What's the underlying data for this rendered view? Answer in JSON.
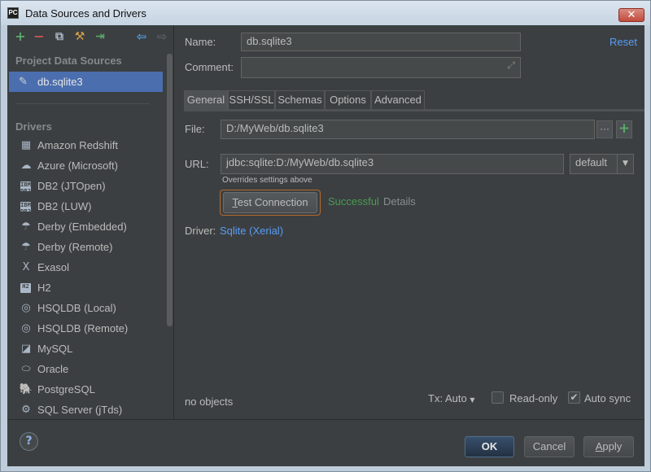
{
  "window": {
    "title": "Data Sources and Drivers",
    "close_glyph": "✕",
    "app_icon_text": "PC"
  },
  "toolbar": {
    "icons": [
      "add-icon",
      "remove-icon",
      "copy-icon",
      "settings-icon",
      "import-icon",
      "back-icon",
      "forward-icon"
    ],
    "glyphs": {
      "add": "+",
      "remove": "−",
      "copy": "⧉",
      "settings": "⚒",
      "import": "⇥",
      "back": "⇦",
      "forward": "⇨"
    }
  },
  "left": {
    "project_section": "Project Data Sources",
    "selected_source": "db.sqlite3",
    "drivers_section": "Drivers",
    "drivers": [
      {
        "label": "Amazon Redshift",
        "icon": "redshift-icon",
        "glyph": "▦"
      },
      {
        "label": "Azure (Microsoft)",
        "icon": "azure-icon",
        "glyph": "☁"
      },
      {
        "label": "DB2 (JTOpen)",
        "icon": "ibm-db2-icon",
        "glyph": "IBM\nDB2"
      },
      {
        "label": "DB2 (LUW)",
        "icon": "ibm-db2-icon",
        "glyph": "IBM\nDB2"
      },
      {
        "label": "Derby (Embedded)",
        "icon": "derby-icon",
        "glyph": "☂"
      },
      {
        "label": "Derby (Remote)",
        "icon": "derby-icon",
        "glyph": "☂"
      },
      {
        "label": "Exasol",
        "icon": "exasol-icon",
        "glyph": "X"
      },
      {
        "label": "H2",
        "icon": "h2-icon",
        "glyph": "H2"
      },
      {
        "label": "HSQLDB (Local)",
        "icon": "hsqldb-icon",
        "glyph": "◎"
      },
      {
        "label": "HSQLDB (Remote)",
        "icon": "hsqldb-icon",
        "glyph": "◎"
      },
      {
        "label": "MySQL",
        "icon": "mysql-icon",
        "glyph": "◪"
      },
      {
        "label": "Oracle",
        "icon": "oracle-icon",
        "glyph": "⬭"
      },
      {
        "label": "PostgreSQL",
        "icon": "postgresql-icon",
        "glyph": "🐘"
      },
      {
        "label": "SQL Server (jTds)",
        "icon": "sqlserver-icon",
        "glyph": "⚙"
      }
    ]
  },
  "form": {
    "name_label": "Name:",
    "name_value": "db.sqlite3",
    "reset_label": "Reset",
    "comment_label": "Comment:",
    "comment_value": "",
    "expand_glyph": "⤢",
    "tabs": [
      {
        "label": "General",
        "active": true
      },
      {
        "label": "SSH/SSL",
        "active": false
      },
      {
        "label": "Schemas",
        "active": false
      },
      {
        "label": "Options",
        "active": false
      },
      {
        "label": "Advanced",
        "active": false
      }
    ],
    "file_label": "File:",
    "file_value": "D:/MyWeb/db.sqlite3",
    "browse_glyph": "···",
    "add_glyph": "+",
    "url_label": "URL:",
    "url_value": "jdbc:sqlite:D:/MyWeb/db.sqlite3",
    "url_mode": "default",
    "dropdown_glyph": "▼",
    "url_hint": "Overrides settings above",
    "test_button": {
      "mnemonic": "T",
      "rest": "est Connection"
    },
    "test_status": "Successful",
    "details_label": "Details",
    "driver_label": "Driver:",
    "driver_value": "Sqlite (Xerial)"
  },
  "status": {
    "objects": "no objects",
    "tx_label": "Tx: Auto",
    "tx_glyph": "▼",
    "readonly_label": "Read-only",
    "readonly_checked": false,
    "autosync_label": "Auto sync",
    "autosync_checked": true,
    "check_glyph": "✔"
  },
  "footer": {
    "help_glyph": "?",
    "ok_label": "OK",
    "cancel_label": "Cancel",
    "apply": {
      "mnemonic": "A",
      "rest": "pply"
    }
  },
  "colors": {
    "accent": "#589df6",
    "success": "#499c54",
    "selection": "#4b6eaf",
    "add_green": "#59a869",
    "remove_red": "#c75450",
    "focus_orange": "#b56b2c"
  }
}
